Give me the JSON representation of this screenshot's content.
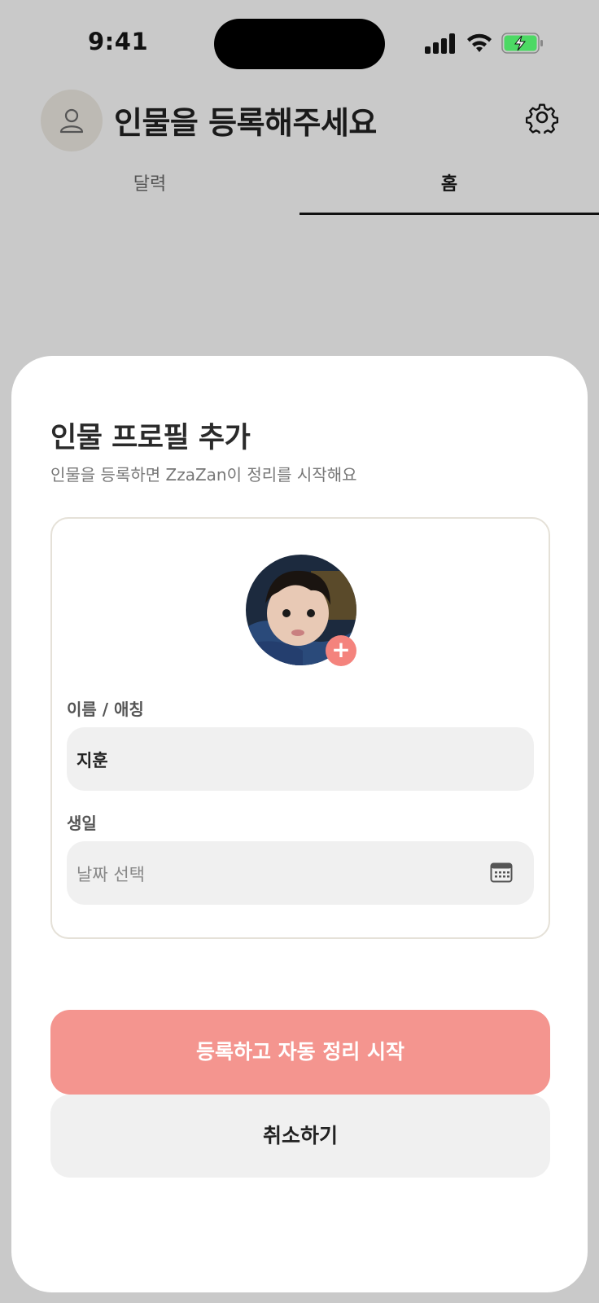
{
  "status_bar": {
    "time": "9:41"
  },
  "header": {
    "title": "인물을 등록해주세요",
    "avatar_icon": "person-icon",
    "settings_icon": "gear-icon"
  },
  "tabs": [
    {
      "label": "달력",
      "selected": false
    },
    {
      "label": "홈",
      "selected": true
    }
  ],
  "sheet": {
    "title": "인물 프로필 추가",
    "subtitle": "인물을 등록하면 ZzaZan이 정리를 시작해요",
    "photo_add_label": "+",
    "name_field": {
      "label": "이름 / 애칭",
      "value": "지훈"
    },
    "birthday_field": {
      "label": "생일",
      "placeholder": "날짜 선택",
      "icon": "calendar-icon"
    },
    "primary_button": "등록하고 자동 정리 시작",
    "secondary_button": "취소하기"
  },
  "colors": {
    "accent": "#f4958f",
    "accent_dark": "#f4837d",
    "battery_green": "#4cd964"
  }
}
